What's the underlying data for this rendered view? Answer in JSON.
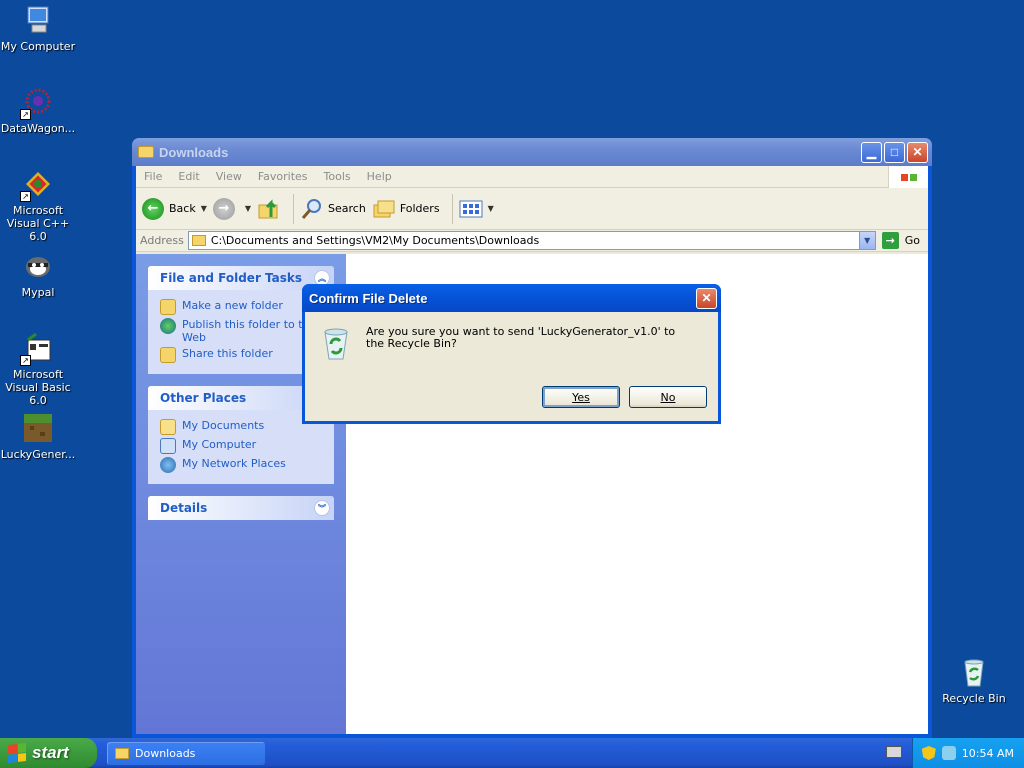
{
  "desktop": {
    "icons": [
      {
        "label": "My Computer"
      },
      {
        "label": "DataWagon..."
      },
      {
        "label": "Microsoft Visual C++ 6.0"
      },
      {
        "label": "Mypal"
      },
      {
        "label": "Microsoft Visual Basic 6.0"
      },
      {
        "label": "LuckyGener..."
      },
      {
        "label": "Recycle Bin"
      }
    ]
  },
  "window": {
    "title": "Downloads",
    "menu": [
      "File",
      "Edit",
      "View",
      "Favorites",
      "Tools",
      "Help"
    ],
    "toolbar": {
      "back": "Back",
      "search": "Search",
      "folders": "Folders"
    },
    "address": {
      "label": "Address",
      "value": "C:\\Documents and Settings\\VM2\\My Documents\\Downloads",
      "go": "Go"
    },
    "tasks_panel": {
      "title": "File and Folder Tasks",
      "links": [
        "Make a new folder",
        "Publish this folder to the Web",
        "Share this folder"
      ]
    },
    "places_panel": {
      "title": "Other Places",
      "links": [
        "My Documents",
        "My Computer",
        "My Network Places"
      ]
    },
    "details_panel": {
      "title": "Details"
    }
  },
  "dialog": {
    "title": "Confirm File Delete",
    "message": "Are you sure you want to send 'LuckyGenerator_v1.0' to the Recycle Bin?",
    "yes": "Yes",
    "no": "No"
  },
  "taskbar": {
    "start": "start",
    "task": "Downloads",
    "clock": "10:54 AM"
  },
  "colors": {
    "desktop": "#0b4a9c",
    "link": "#215dc6",
    "titlebar_active": "#0553d8"
  }
}
